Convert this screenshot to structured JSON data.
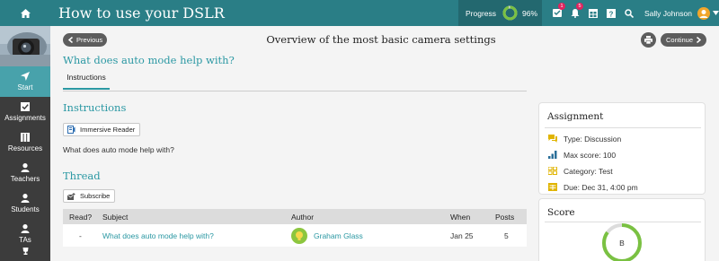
{
  "header": {
    "title": "How to use your DSLR",
    "progress_label": "Progress",
    "progress_value": "96%",
    "progress_fraction": 0.96,
    "inbox_badge": "1",
    "notifications_badge": "5",
    "user_name": "Sally Johnson",
    "accent_color": "#2a7e86"
  },
  "sidebar": {
    "items": [
      {
        "label": "Start",
        "icon": "compass-arrow-icon",
        "active": true
      },
      {
        "label": "Assignments",
        "icon": "checkbox-icon"
      },
      {
        "label": "Resources",
        "icon": "books-icon"
      },
      {
        "label": "Teachers",
        "icon": "person-icon"
      },
      {
        "label": "Students",
        "icon": "person-icon"
      },
      {
        "label": "TAs",
        "icon": "person-icon"
      }
    ]
  },
  "main": {
    "prev_label": "Previous",
    "continue_label": "Continue",
    "page_title": "Overview of the most basic camera settings",
    "question_title": "What does auto mode help with?",
    "tab_label": "Instructions",
    "instructions_heading": "Instructions",
    "immersive_reader_label": "Immersive Reader",
    "question_text": "What does auto mode help with?",
    "thread_heading": "Thread",
    "subscribe_label": "Subscribe",
    "table": {
      "headers": {
        "read": "Read?",
        "subject": "Subject",
        "author": "Author",
        "when": "When",
        "posts": "Posts"
      },
      "rows": [
        {
          "read": "-",
          "subject": "What does auto mode help with?",
          "author": "Graham Glass",
          "when": "Jan 25",
          "posts": "5"
        }
      ]
    }
  },
  "assignment": {
    "title": "Assignment",
    "type": "Type: Discussion",
    "max_score": "Max score: 100",
    "category": "Category: Test",
    "due": "Due: Dec 31, 4:00 pm"
  },
  "score": {
    "title": "Score",
    "grade": "B",
    "fraction": 0.85
  }
}
